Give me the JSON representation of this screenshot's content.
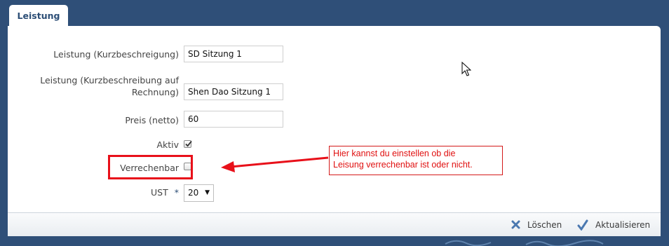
{
  "tab": {
    "label": "Leistung"
  },
  "form": {
    "kurzbeschreibung": {
      "label": "Leistung (Kurzbeschreigung)",
      "value": "SD Sitzung 1"
    },
    "rechnung": {
      "label_line1": "Leistung (Kurzbeschreibung auf",
      "label_line2": "Rechnung)",
      "value": "Shen Dao Sitzung 1"
    },
    "preis": {
      "label": "Preis (netto)",
      "value": "60"
    },
    "aktiv": {
      "label": "Aktiv",
      "checked": true
    },
    "verrechenbar": {
      "label": "Verrechenbar",
      "checked": false
    },
    "ust": {
      "label": "UST",
      "required_marker": "*",
      "selected": "20"
    }
  },
  "annotation": {
    "line1": "Hier kannst du einstellen ob die",
    "line2": "Leisung verrechenbar ist oder nicht.",
    "color": "#e01010"
  },
  "footer": {
    "delete_label": "Löschen",
    "update_label": "Aktualisieren"
  },
  "colors": {
    "background": "#2f4f78",
    "accent": "#2c4e76",
    "highlight": "#e8101a"
  }
}
